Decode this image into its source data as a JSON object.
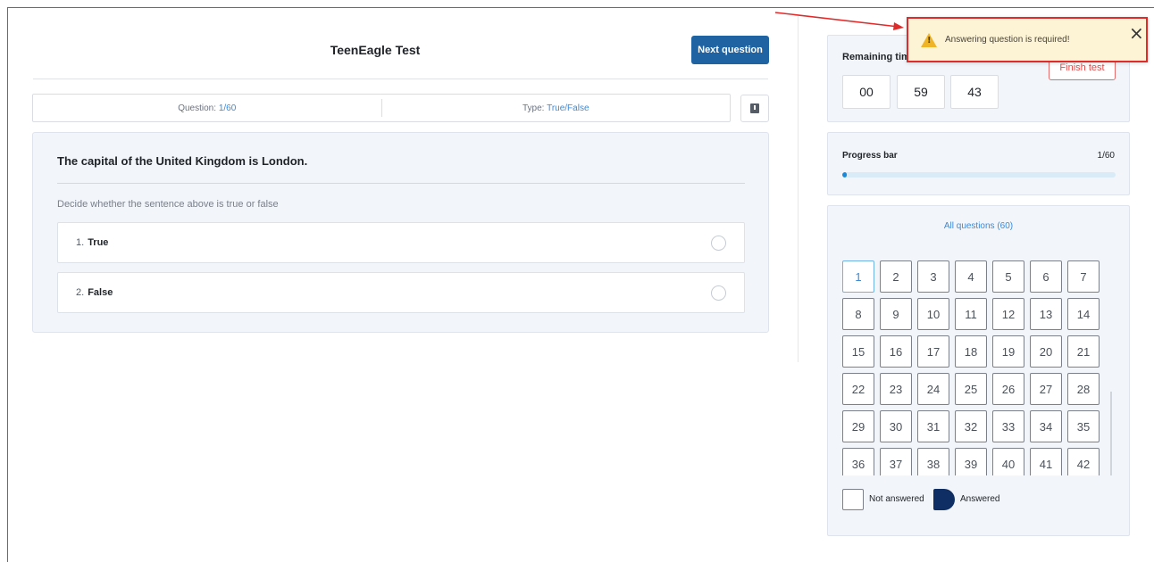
{
  "header": {
    "title": "TeenEagle Test",
    "next_label": "Next question"
  },
  "info": {
    "question_label": "Question:",
    "question_value": "1/60",
    "type_label": "Type:",
    "type_value": "True/False"
  },
  "question": {
    "text": "The capital of the United Kingdom is London.",
    "instruction": "Decide whether the sentence above is true or false",
    "options": [
      {
        "num": "1.",
        "label": "True"
      },
      {
        "num": "2.",
        "label": "False"
      }
    ]
  },
  "timer": {
    "label": "Remaining tim",
    "finish_label": "Finish test",
    "hours": "00",
    "minutes": "59",
    "seconds": "43"
  },
  "progress": {
    "label": "Progress bar",
    "count": "1/60",
    "fraction": 0.0167
  },
  "questions": {
    "title": "All questions (60)",
    "current": 1,
    "visible_numbers": [
      1,
      2,
      3,
      4,
      5,
      6,
      7,
      8,
      9,
      10,
      11,
      12,
      13,
      14,
      15,
      16,
      17,
      18,
      19,
      20,
      21,
      22,
      23,
      24,
      25,
      26,
      27,
      28,
      29,
      30,
      31,
      32,
      33,
      34,
      35,
      36,
      37,
      38,
      39,
      40,
      41,
      42
    ]
  },
  "legend": {
    "not_answered": "Not answered",
    "answered": "Answered"
  },
  "toast": {
    "message": "Answering question is required!"
  },
  "colors": {
    "primary": "#1f63a3",
    "accent_blue": "#3b8ad8",
    "progress_fill": "#1a8ad8",
    "danger": "#e04c4c",
    "answered": "#0f2f64",
    "toast_bg": "#fdf4d6",
    "annotation_red": "#e02b2b"
  }
}
